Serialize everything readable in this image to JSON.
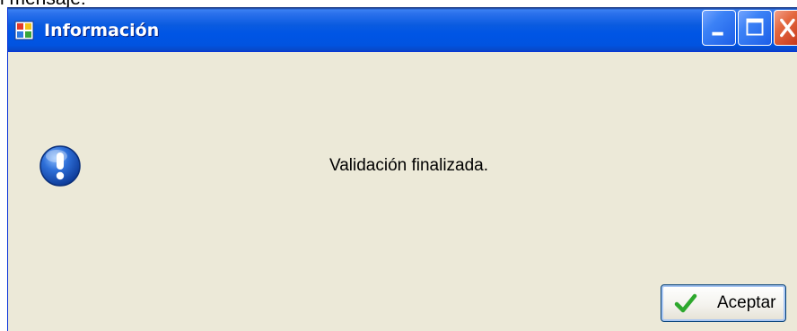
{
  "page": {
    "fragment_text": "l mensaje:"
  },
  "window": {
    "title": "Información",
    "app_icon": "app-window-icon",
    "controls": {
      "minimize_icon": "minimize-icon",
      "maximize_icon": "maximize-icon",
      "close_icon": "close-icon"
    }
  },
  "dialog": {
    "icon": "info-exclamation-icon",
    "message": "Validación finalizada.",
    "ok_button": {
      "label": "Aceptar",
      "icon": "checkmark-icon"
    }
  },
  "colors": {
    "titlebar": "#0055E5",
    "dialog_background": "#ECE9D8",
    "close_button": "#E4683F",
    "accent_blue": "#1E5AC8",
    "check_green": "#2DA82D"
  }
}
